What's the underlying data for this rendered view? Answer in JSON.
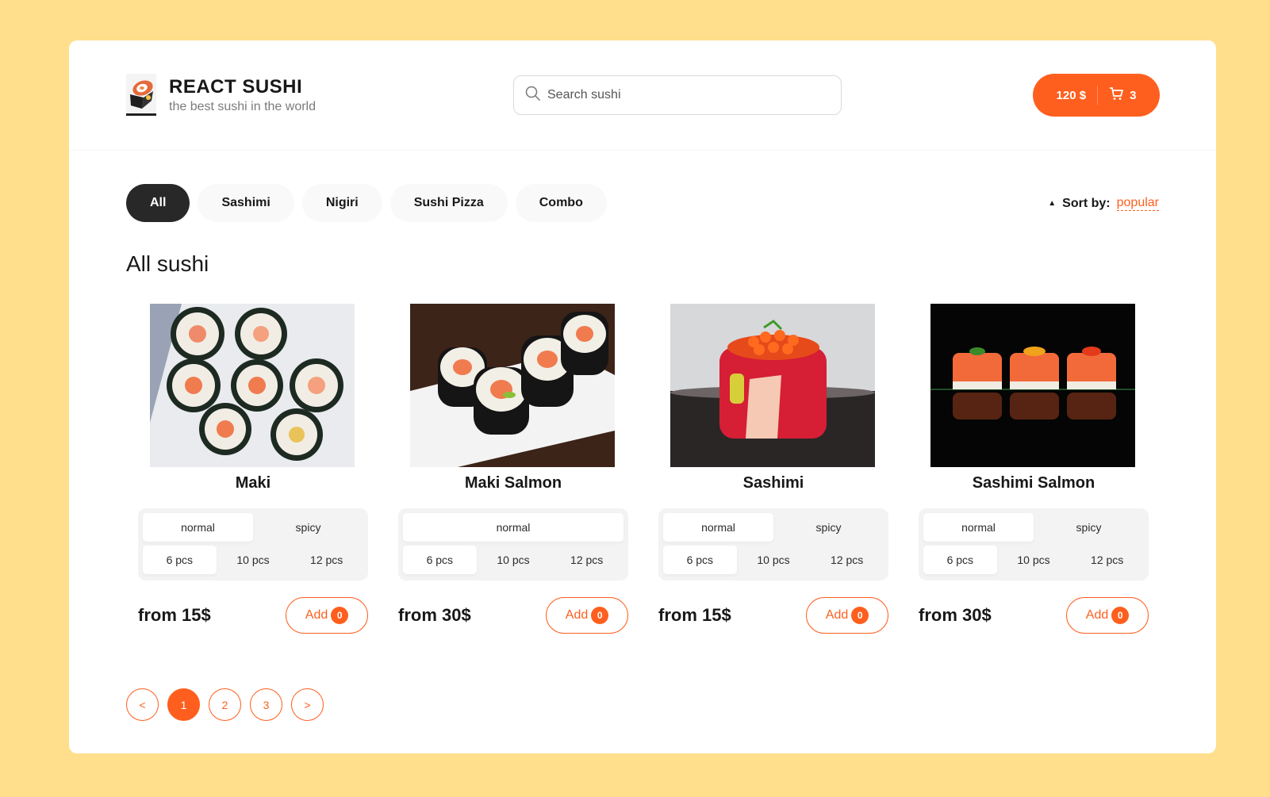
{
  "header": {
    "title": "REACT SUSHI",
    "subtitle": "the best sushi in the world",
    "search_placeholder": "Search sushi",
    "cart_total": "120 $",
    "cart_count": "3"
  },
  "categories": [
    "All",
    "Sashimi",
    "Nigiri",
    "Sushi Pizza",
    "Combo"
  ],
  "active_category": "All",
  "sort": {
    "label": "Sort by:",
    "value": "popular"
  },
  "section_title": "All sushi",
  "products": [
    {
      "name": "Maki",
      "types": [
        "normal",
        "spicy"
      ],
      "sizes": [
        "6 pcs",
        "10 pcs",
        "12 pcs"
      ],
      "price": "from 15$",
      "add_label": "Add",
      "count": "0"
    },
    {
      "name": "Maki Salmon",
      "types": [
        "normal"
      ],
      "sizes": [
        "6 pcs",
        "10 pcs",
        "12 pcs"
      ],
      "price": "from 30$",
      "add_label": "Add",
      "count": "0"
    },
    {
      "name": "Sashimi",
      "types": [
        "normal",
        "spicy"
      ],
      "sizes": [
        "6 pcs",
        "10 pcs",
        "12 pcs"
      ],
      "price": "from 15$",
      "add_label": "Add",
      "count": "0"
    },
    {
      "name": "Sashimi Salmon",
      "types": [
        "normal",
        "spicy"
      ],
      "sizes": [
        "6 pcs",
        "10 pcs",
        "12 pcs"
      ],
      "price": "from 30$",
      "add_label": "Add",
      "count": "0"
    }
  ],
  "pagination": {
    "prev": "<",
    "pages": [
      "1",
      "2",
      "3"
    ],
    "next": ">",
    "current": "1"
  },
  "colors": {
    "accent": "#fe5f1e",
    "background": "#ffdf8c",
    "dark": "#282828"
  }
}
